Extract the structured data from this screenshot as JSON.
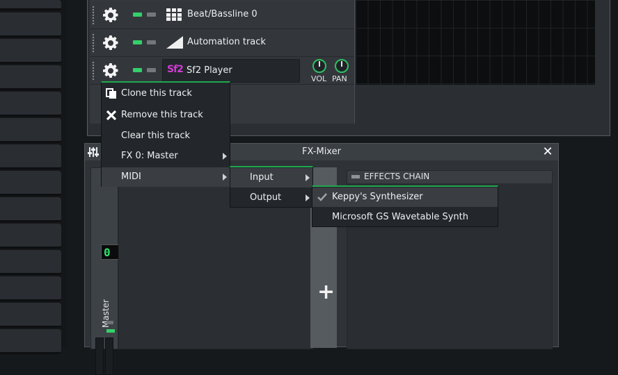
{
  "tracks": [
    {
      "name": "Beat/Bassline 0",
      "icon": "beat-bassline-icon"
    },
    {
      "name": "Automation track",
      "icon": "automation-icon"
    },
    {
      "name": "Sf2 Player",
      "icon": "sf2-icon",
      "icon_text": "Sf2"
    }
  ],
  "knobs": {
    "vol_label": "VOL",
    "pan_label": "PAN"
  },
  "context_menu": {
    "items": [
      {
        "label": "Clone this track",
        "icon": "clone-icon"
      },
      {
        "label": "Remove this track",
        "icon": "remove-icon"
      },
      {
        "label": "Clear this track"
      },
      {
        "label": "FX 0: Master",
        "submenu": true
      },
      {
        "label": "MIDI",
        "submenu": true,
        "selected": true
      }
    ]
  },
  "midi_submenu": {
    "items": [
      {
        "label": "Input",
        "submenu": true,
        "selected": true
      },
      {
        "label": "Output",
        "submenu": true
      }
    ]
  },
  "output_submenu": {
    "items": [
      {
        "label": "Keppy's Synthesizer",
        "checked": true,
        "selected": true
      },
      {
        "label": "Microsoft GS Wavetable Synth",
        "checked": false
      }
    ]
  },
  "fx_mixer": {
    "title": "FX-Mixer",
    "master_label": "Master",
    "channel_number": "0",
    "effects_chain_label": "EFFECTS CHAIN",
    "add_label": "+"
  },
  "colors": {
    "accent_green": "#34d06a",
    "sf2_magenta": "#d23ad6"
  }
}
